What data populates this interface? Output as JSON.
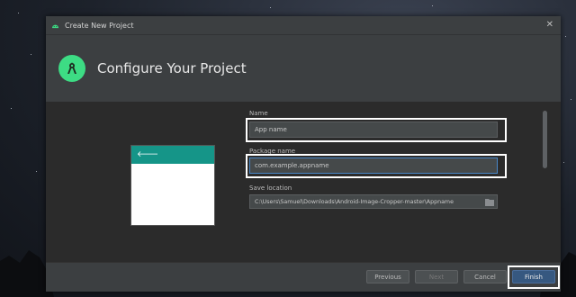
{
  "window": {
    "title": "Create New Project"
  },
  "header": {
    "title": "Configure Your Project",
    "logo_icon": "android-studio-icon"
  },
  "form": {
    "name_label": "Name",
    "name_value": "App name",
    "package_label": "Package name",
    "package_value": "com.example.appname",
    "location_label": "Save location",
    "location_value": "C:\\Users\\Samuel\\Downloads\\Android-Image-Cropper-master\\Appname"
  },
  "preview": {
    "back_icon": "arrow-left-icon"
  },
  "footer": {
    "previous_label": "Previous",
    "next_label": "Next",
    "cancel_label": "Cancel",
    "finish_label": "Finish"
  },
  "colors": {
    "accent": "#3ddc84",
    "toolbar": "#159588",
    "primary_button": "#365880",
    "highlight": "#ffffff"
  }
}
